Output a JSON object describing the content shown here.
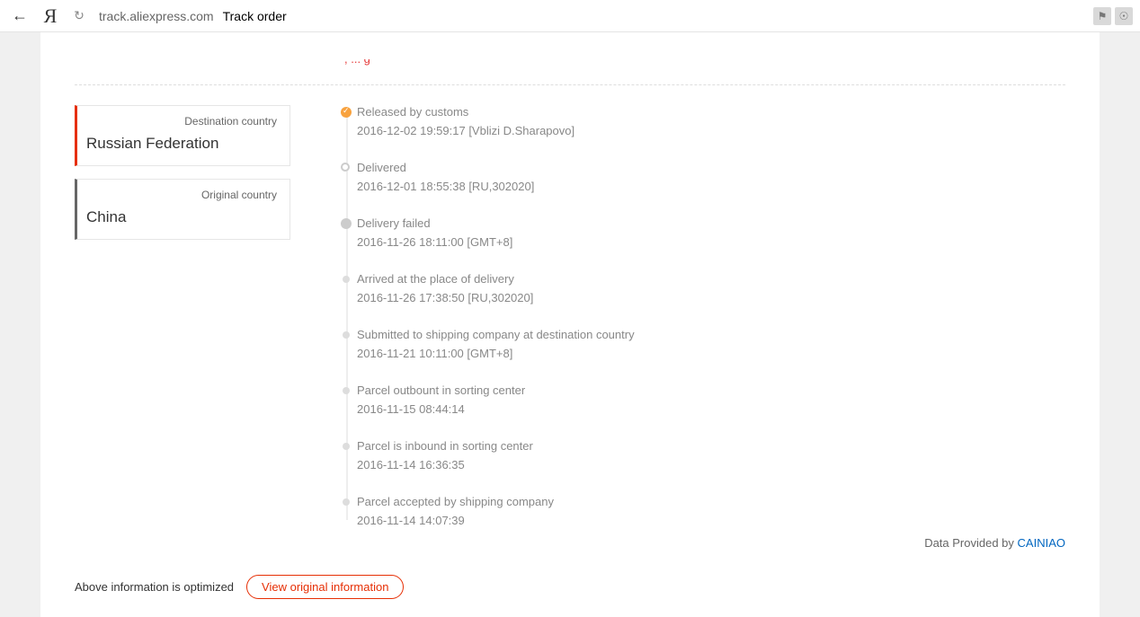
{
  "browser": {
    "url": "track.aliexpress.com",
    "title": "Track order"
  },
  "cutoff": ", ... g",
  "countries": {
    "dest_label": "Destination country",
    "dest_value": "Russian Federation",
    "orig_label": "Original country",
    "orig_value": "China"
  },
  "timeline": [
    {
      "dot": "orange",
      "title": "Released by customs",
      "time": "2016-12-02 19:59:17 [Vblizi D.Sharapovo]"
    },
    {
      "dot": "outline",
      "title": "Delivered",
      "time": "2016-12-01 18:55:38 [RU,302020]"
    },
    {
      "dot": "big",
      "title": "Delivery failed",
      "time": "2016-11-26 18:11:00 [GMT+8]"
    },
    {
      "dot": "small",
      "title": "Arrived at the place of delivery",
      "time": "2016-11-26 17:38:50 [RU,302020]"
    },
    {
      "dot": "small",
      "title": "Submitted to shipping company at destination country",
      "time": "2016-11-21 10:11:00 [GMT+8]"
    },
    {
      "dot": "small",
      "title": "Parcel outbount in sorting center",
      "time": "2016-11-15 08:44:14"
    },
    {
      "dot": "small",
      "title": "Parcel is inbound in sorting center",
      "time": "2016-11-14 16:36:35"
    },
    {
      "dot": "small",
      "title": "Parcel accepted by shipping company",
      "time": "2016-11-14 14:07:39"
    }
  ],
  "provided": {
    "text": "Data Provided by ",
    "link": "CAINIAO"
  },
  "footer": {
    "text": "Above information is optimized",
    "button": "View original information"
  }
}
